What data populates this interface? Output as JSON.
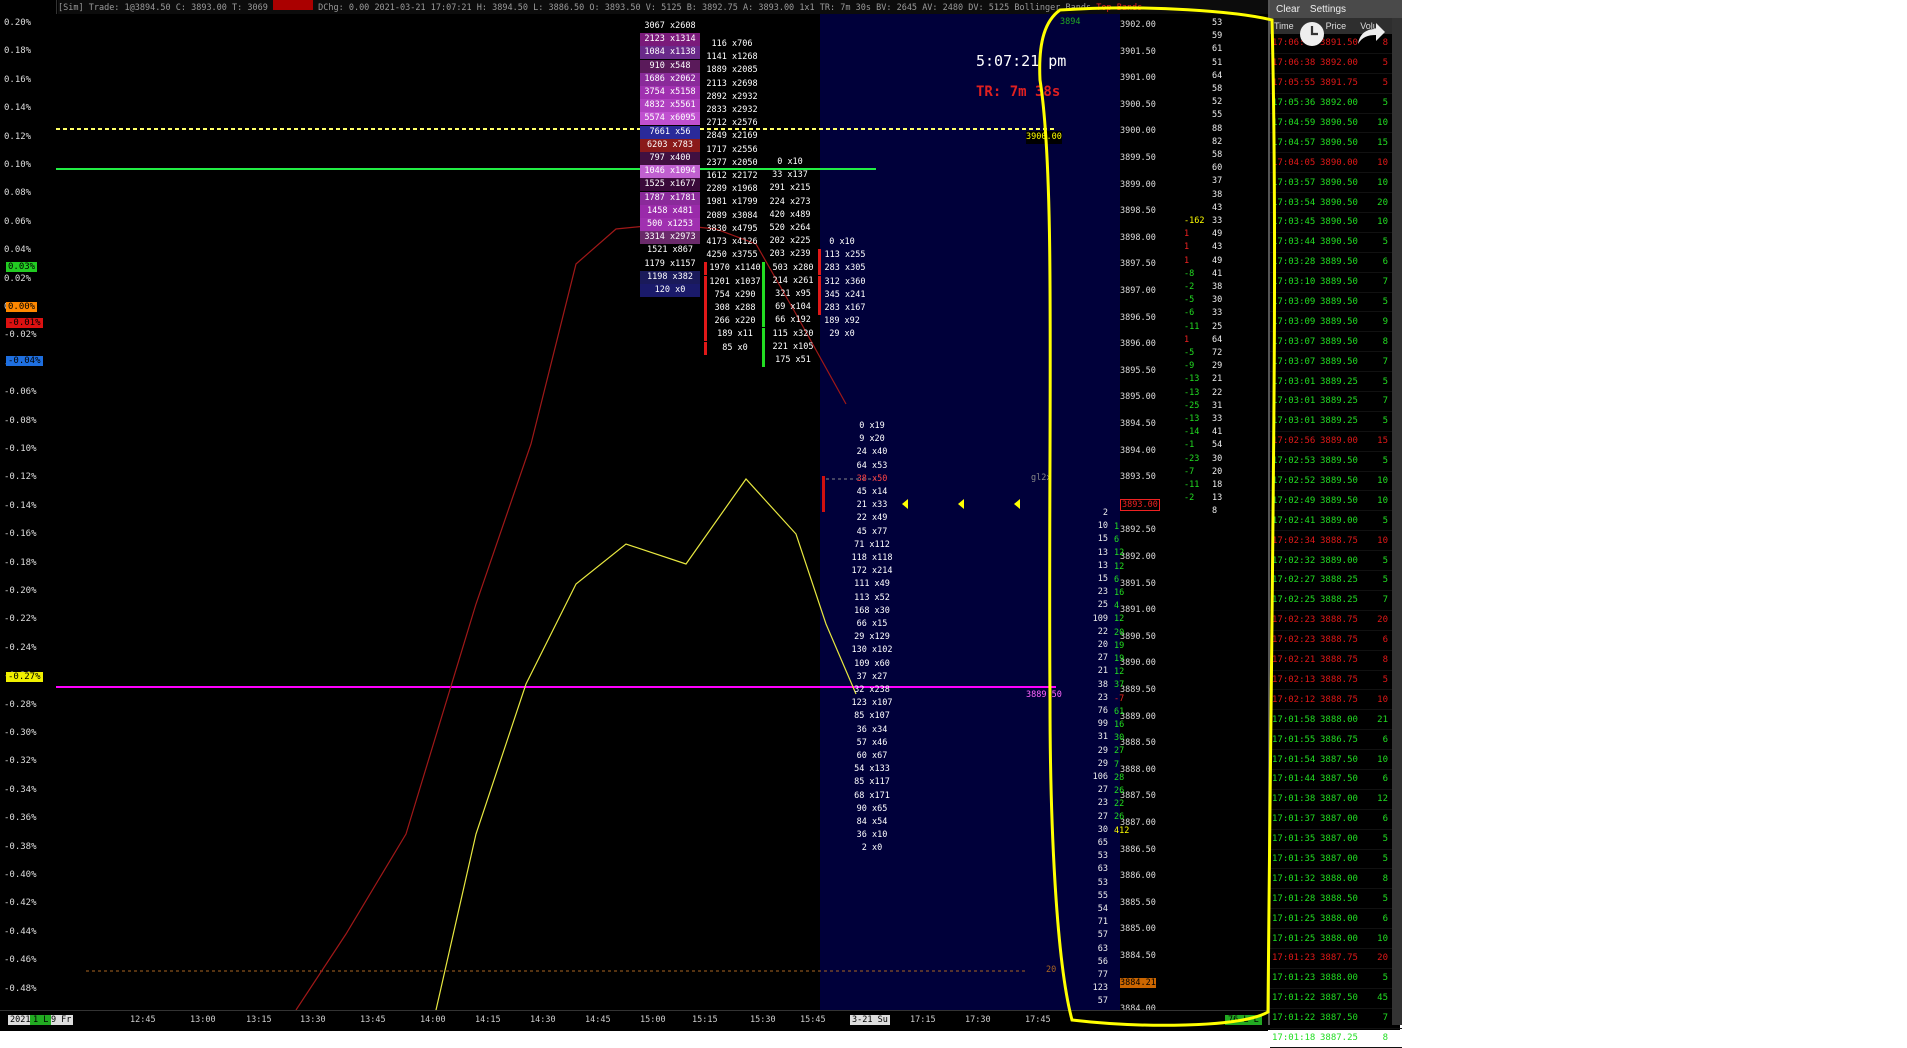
{
  "status_bar": {
    "mode": "[Sim]",
    "trade_label": "Trade: 1@3894.50",
    "close": "C: 3893.00",
    "ticks": "T: 3069",
    "hidden_badge": "",
    "dchg": "DChg: 0.00",
    "timestamp": "2021-03-21 17:07:21",
    "high": "H: 3894.50",
    "low": "L: 3886.50",
    "open": "O: 3893.50",
    "volume": "V: 5125",
    "bid": "B: 3892.75",
    "ask": "A: 3893.00",
    "bar_type": "1x1",
    "tr": "TR: 7m 30s",
    "bv": "BV: 2645",
    "av": "AV: 2480",
    "dv": "DV: 5125",
    "study": "Bollinger Bands",
    "top_bands": "Top Bands"
  },
  "clock": "5:07:21 pm",
  "timer": "TR: 7m 38s",
  "y_axis_ticks": [
    "0.20%",
    "0.18%",
    "0.16%",
    "0.14%",
    "0.12%",
    "0.10%",
    "0.08%",
    "0.06%",
    "0.04%",
    "0.02%",
    "0.00%",
    "-0.02%",
    "-0.04%",
    "-0.06%",
    "-0.08%",
    "-0.10%",
    "-0.12%",
    "-0.14%",
    "-0.16%",
    "-0.18%",
    "-0.20%",
    "-0.22%",
    "-0.24%",
    "-0.26%",
    "-0.28%",
    "-0.30%",
    "-0.32%",
    "-0.34%",
    "-0.36%",
    "-0.38%",
    "-0.40%",
    "-0.42%",
    "-0.44%",
    "-0.46%",
    "-0.48%"
  ],
  "y_markers": [
    {
      "label": "0.03%",
      "color": "#22cc22",
      "row": 9
    },
    {
      "label": "0.00%",
      "color": "#ff8800",
      "row": 10
    },
    {
      "label": "-0.01%",
      "color": "#dd1111",
      "row": 11
    },
    {
      "label": "-0.04%",
      "color": "#1e6fe0",
      "row": 12
    },
    {
      "label": "-0.27%",
      "color": "#f0f000",
      "row": 23
    }
  ],
  "x_axis_ticks": [
    "2021-3-19 Fr",
    "12:45",
    "13:00",
    "13:15",
    "13:30",
    "13:45",
    "14:00",
    "14:15",
    "14:30",
    "14:45",
    "15:00",
    "15:15",
    "15:30",
    "15:45",
    "3-21 Su",
    "17:15",
    "17:30",
    "17:45"
  ],
  "x_corner_left": "1 L",
  "x_corner_right": "76 L L",
  "level_labels": {
    "yellow_level": "3900.00",
    "magenta_level": "3889.50",
    "grey_level": "gl2x",
    "bottom_level": "20",
    "sm_tag": "3894"
  },
  "footprint": {
    "col1": [
      {
        "t": "3067 x2608",
        "bg": ""
      },
      {
        "t": "2123 x1314",
        "bg": "#7a1a7a"
      },
      {
        "t": "1084 x1138",
        "bg": "#6a2a8a"
      },
      {
        "t": "910 x548",
        "bg": "#5a1a5a"
      },
      {
        "t": "1686 x2062",
        "bg": "#8a2a9a"
      },
      {
        "t": "3754 x5158",
        "bg": "#a030b0"
      },
      {
        "t": "4832 x5561",
        "bg": "#b040c0"
      },
      {
        "t": "5574 x6095",
        "bg": "#c050d0"
      },
      {
        "t": "7661 x56",
        "bg": "#2a2a9a"
      },
      {
        "t": "6203 x783",
        "bg": "#8a1a1a"
      },
      {
        "t": "797 x400",
        "bg": "#401040"
      },
      {
        "t": "1046 x1094",
        "bg": "#c060d0"
      },
      {
        "t": "1525 x1677",
        "bg": "#3a0a3a"
      },
      {
        "t": "1787 x1781",
        "bg": "#8a2a9a"
      },
      {
        "t": "1458 x481",
        "bg": "#9a2aaa"
      },
      {
        "t": "500 x1253",
        "bg": "#a030b0"
      },
      {
        "t": "3314 x2973",
        "bg": "#6a2a6a"
      },
      {
        "t": "1521 x867",
        "bg": ""
      },
      {
        "t": "1179 x1157",
        "bg": ""
      },
      {
        "t": "1198 x382",
        "bg": "#1a1a5a"
      },
      {
        "t": "120 x0",
        "bg": "#1a1a6a"
      }
    ],
    "col2": [
      "116 x706",
      "1141 x1268",
      "1889 x2085",
      "2113 x2698",
      "2892 x2932",
      "2833 x2932",
      "2712 x2576",
      "2849 x2169",
      "1717 x2556",
      "2377 x2050",
      "1612 x2172",
      "2289 x1968",
      "1981 x1799",
      "2089 x3084",
      "3830 x4795",
      "4173 x4126",
      "4250 x3755",
      "1970 x1140",
      "1201 x1037",
      "754 x290",
      "308 x288",
      "266 x220",
      "189 x11",
      "85 x0"
    ],
    "col3": [
      "0 x10",
      "33 x137",
      "291 x215",
      "224 x273",
      "420 x489",
      "520 x264",
      "202 x225",
      "203 x239",
      "503 x280",
      "214 x261",
      "321 x95",
      "69 x104",
      "66 x192",
      "115 x320",
      "221 x105",
      "175 x51"
    ],
    "col4": [
      "0 x10",
      "113 x255",
      "283 x305",
      "312 x360",
      "345 x241",
      "283 x167",
      "189 x92",
      "29 x0"
    ],
    "col5": [
      "0 x19",
      "9 x20",
      "24 x40",
      "64 x53",
      "38 x50",
      "45 x14",
      "21 x33",
      "22 x49",
      "45 x77",
      "71 x112",
      "118 x118",
      "172 x214",
      "111 x49",
      "113 x52",
      "168 x30",
      "66 x15",
      "29 x129",
      "130 x102",
      "109 x60",
      "37 x27",
      "32 x238",
      "123 x107",
      "85 x107",
      "36 x34",
      "57 x46",
      "60 x67",
      "54 x133",
      "85 x117",
      "68 x171",
      "90 x65",
      "84 x54",
      "36 x10",
      "2 x0"
    ]
  },
  "price_ladder": {
    "prices": [
      "3902.00",
      "3901.50",
      "3901.00",
      "3900.50",
      "3900.00",
      "3899.50",
      "3899.00",
      "3898.50",
      "3898.00",
      "3897.50",
      "3897.00",
      "3896.50",
      "3896.00",
      "3895.50",
      "3895.00",
      "3894.50",
      "3894.00",
      "3893.50",
      "3893.00",
      "3892.50",
      "3892.00",
      "3891.50",
      "3891.00",
      "3890.50",
      "3890.00",
      "3889.50",
      "3889.00",
      "3888.50",
      "3888.00",
      "3887.50",
      "3887.00",
      "3886.50",
      "3886.00",
      "3885.50",
      "3885.00",
      "3884.50",
      "3884.21",
      "3884.00"
    ],
    "current_price": "3893.00",
    "vol_right": [
      "53",
      "59",
      "61",
      "51",
      "64",
      "58",
      "52",
      "55",
      "88",
      "82",
      "58",
      "60",
      "37",
      "38",
      "43",
      "33",
      "49",
      "43",
      "49",
      "41",
      "38",
      "30",
      "33",
      "25",
      "64",
      "72",
      "29",
      "21",
      "22",
      "31",
      "33",
      "41",
      "54",
      "30",
      "20",
      "18",
      "13",
      "8"
    ],
    "delta_right": [
      "-162",
      "1",
      "1",
      "1",
      "-8",
      "-2",
      "-5",
      "-6",
      "-11",
      "1",
      "-5",
      "-9",
      "-13",
      "-13",
      "-25",
      "-13",
      "-14",
      "-1",
      "-23",
      "-7",
      "-11",
      "-2"
    ],
    "vol_left": [
      "2",
      "10",
      "15",
      "13",
      "13",
      "15",
      "23",
      "25",
      "109",
      "22",
      "20",
      "27",
      "21",
      "38",
      "23",
      "76",
      "99",
      "31",
      "29",
      "29",
      "106",
      "27",
      "23",
      "27",
      "30",
      "65",
      "53",
      "63",
      "53",
      "55",
      "54",
      "71",
      "57",
      "63",
      "56",
      "77",
      "123",
      "57"
    ],
    "delta_left": [
      "1",
      "6",
      "12",
      "12",
      "6",
      "16",
      "4",
      "12",
      "20",
      "19",
      "19",
      "12",
      "37",
      "-7",
      "61",
      "16",
      "30",
      "27",
      "7",
      "28",
      "26",
      "22",
      "26",
      "412"
    ]
  },
  "time_and_sales": {
    "buttons": [
      "Clear",
      "Settings"
    ],
    "columns": [
      "Time",
      "Price",
      "Volu"
    ],
    "rows": [
      [
        "17:06:44",
        "3891.50",
        "8",
        "r"
      ],
      [
        "17:06:38",
        "3892.00",
        "5",
        "r"
      ],
      [
        "17:05:55",
        "3891.75",
        "5",
        "r"
      ],
      [
        "17:05:36",
        "3892.00",
        "5",
        "g"
      ],
      [
        "17:04:59",
        "3890.50",
        "10",
        "g"
      ],
      [
        "17:04:57",
        "3890.50",
        "15",
        "g"
      ],
      [
        "17:04:05",
        "3890.00",
        "10",
        "r"
      ],
      [
        "17:03:57",
        "3890.50",
        "10",
        "g"
      ],
      [
        "17:03:54",
        "3890.50",
        "20",
        "g"
      ],
      [
        "17:03:45",
        "3890.50",
        "10",
        "g"
      ],
      [
        "17:03:44",
        "3890.50",
        "5",
        "g"
      ],
      [
        "17:03:28",
        "3889.50",
        "6",
        "g"
      ],
      [
        "17:03:10",
        "3889.50",
        "7",
        "g"
      ],
      [
        "17:03:09",
        "3889.50",
        "5",
        "g"
      ],
      [
        "17:03:09",
        "3889.50",
        "9",
        "g"
      ],
      [
        "17:03:07",
        "3889.50",
        "8",
        "g"
      ],
      [
        "17:03:07",
        "3889.50",
        "7",
        "g"
      ],
      [
        "17:03:01",
        "3889.25",
        "5",
        "g"
      ],
      [
        "17:03:01",
        "3889.25",
        "7",
        "g"
      ],
      [
        "17:03:01",
        "3889.25",
        "5",
        "g"
      ],
      [
        "17:02:56",
        "3889.00",
        "15",
        "r"
      ],
      [
        "17:02:53",
        "3889.50",
        "5",
        "g"
      ],
      [
        "17:02:52",
        "3889.50",
        "10",
        "g"
      ],
      [
        "17:02:49",
        "3889.50",
        "10",
        "g"
      ],
      [
        "17:02:41",
        "3889.00",
        "5",
        "g"
      ],
      [
        "17:02:34",
        "3888.75",
        "10",
        "r"
      ],
      [
        "17:02:32",
        "3889.00",
        "5",
        "g"
      ],
      [
        "17:02:27",
        "3888.25",
        "5",
        "g"
      ],
      [
        "17:02:25",
        "3888.25",
        "7",
        "g"
      ],
      [
        "17:02:23",
        "3888.75",
        "20",
        "r"
      ],
      [
        "17:02:23",
        "3888.75",
        "6",
        "r"
      ],
      [
        "17:02:21",
        "3888.75",
        "8",
        "r"
      ],
      [
        "17:02:13",
        "3888.75",
        "5",
        "r"
      ],
      [
        "17:02:12",
        "3888.75",
        "10",
        "r"
      ],
      [
        "17:01:58",
        "3888.00",
        "21",
        "g"
      ],
      [
        "17:01:55",
        "3886.75",
        "6",
        "g"
      ],
      [
        "17:01:54",
        "3887.50",
        "10",
        "g"
      ],
      [
        "17:01:44",
        "3887.50",
        "6",
        "g"
      ],
      [
        "17:01:38",
        "3887.00",
        "12",
        "g"
      ],
      [
        "17:01:37",
        "3887.00",
        "6",
        "g"
      ],
      [
        "17:01:35",
        "3887.00",
        "5",
        "g"
      ],
      [
        "17:01:35",
        "3887.00",
        "5",
        "g"
      ],
      [
        "17:01:32",
        "3888.00",
        "8",
        "g"
      ],
      [
        "17:01:28",
        "3888.50",
        "5",
        "g"
      ],
      [
        "17:01:25",
        "3888.00",
        "6",
        "g"
      ],
      [
        "17:01:25",
        "3888.00",
        "10",
        "g"
      ],
      [
        "17:01:23",
        "3887.75",
        "20",
        "r"
      ],
      [
        "17:01:23",
        "3888.00",
        "5",
        "g"
      ],
      [
        "17:01:22",
        "3887.50",
        "45",
        "g"
      ],
      [
        "17:01:22",
        "3887.50",
        "7",
        "g"
      ],
      [
        "17:01:18",
        "3887.25",
        "8",
        "g"
      ]
    ]
  },
  "colors": {
    "bid_red": "#e01818",
    "ask_green": "#22dd22",
    "annotation": "#ffff00",
    "magenta": "#ff00ff",
    "green_line": "#22ee44",
    "yellow_dashed": "#ffff66",
    "navy_zone": "#00003a"
  }
}
